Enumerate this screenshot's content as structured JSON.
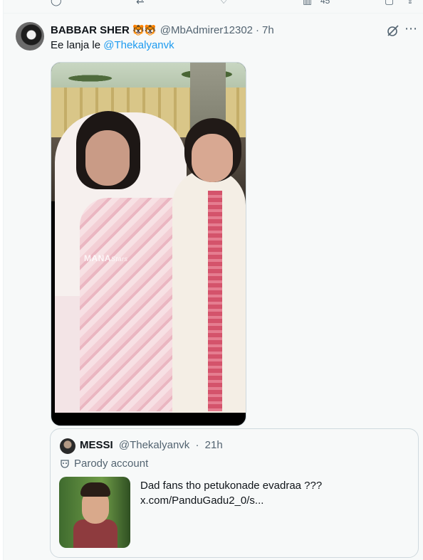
{
  "previous_tweet": {
    "action_count": "45"
  },
  "tweet": {
    "display_name": "BABBAR SHER",
    "name_emojis": "🐯🐯",
    "handle": "@MbAdmirer12302",
    "separator": "·",
    "time": "7h",
    "text_prefix": "Ee lanja le ",
    "mention": "@Thekalyanvk",
    "media_watermark_main": "MANA",
    "media_watermark_script": "Stars",
    "more_icon": "⋯"
  },
  "quoted_tweet": {
    "display_name": "MESSI",
    "handle": "@Thekalyanvk",
    "separator": "·",
    "time": "21h",
    "label": "Parody account",
    "text_line1": "Dad fans tho petukonade evadraa ???",
    "text_line2": "x.com/PanduGadu2_0/s..."
  },
  "colors": {
    "link": "#1d9bf0",
    "secondary_text": "#536471",
    "primary_text": "#0f1419",
    "background": "#f7f9f9",
    "border": "#cfd9de"
  }
}
